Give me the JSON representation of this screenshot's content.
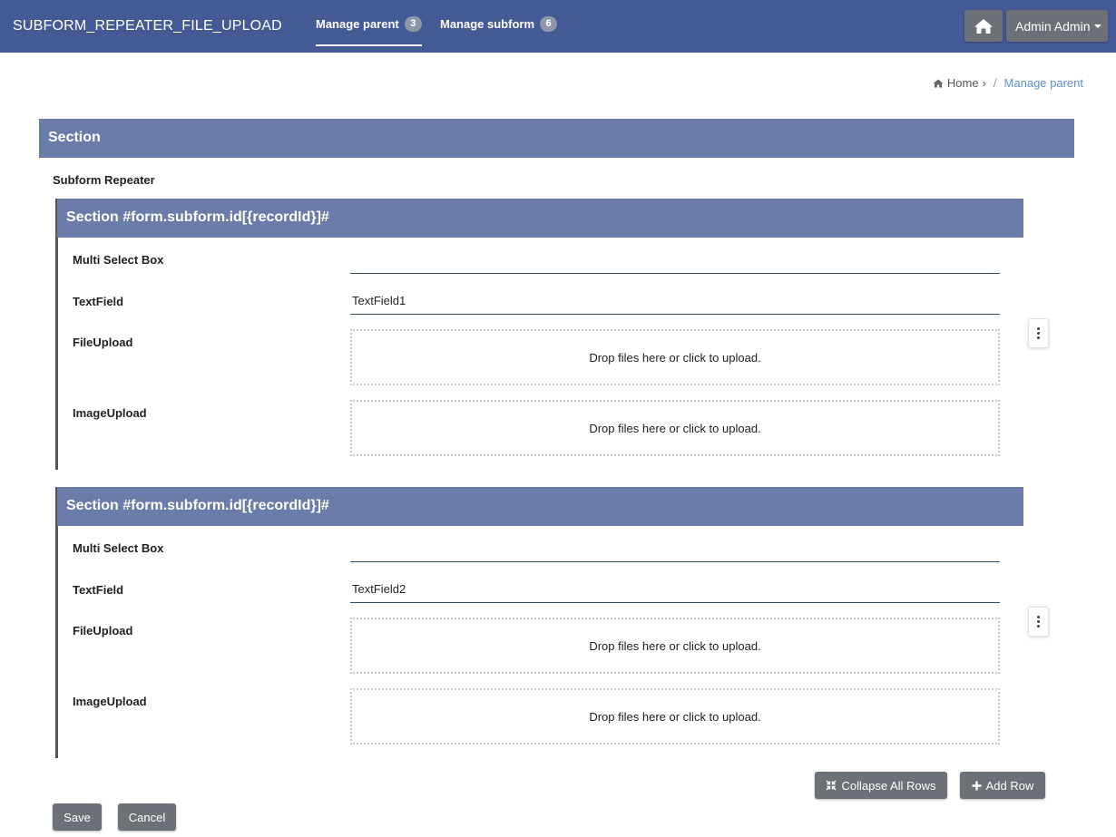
{
  "header": {
    "app_title": "SUBFORM_REPEATER_FILE_UPLOAD",
    "tabs": [
      {
        "label": "Manage parent",
        "badge": "3",
        "active": true
      },
      {
        "label": "Manage subform",
        "badge": "6",
        "active": false
      }
    ],
    "home_icon": "home-icon",
    "user_label": "Admin Admin"
  },
  "breadcrumb": {
    "home": "Home",
    "current": "Manage parent"
  },
  "section": {
    "title": "Section",
    "subform_label": "Subform Repeater"
  },
  "rows": [
    {
      "title": "Section #form.subform.id[{recordId}]#",
      "multi_select_label": "Multi Select Box",
      "multi_select_value": "",
      "textfield_label": "TextField",
      "textfield_value": "TextField1",
      "fileupload_label": "FileUpload",
      "fileupload_text": "Drop files here or click to upload.",
      "imageupload_label": "ImageUpload",
      "imageupload_text": "Drop files here or click to upload."
    },
    {
      "title": "Section #form.subform.id[{recordId}]#",
      "multi_select_label": "Multi Select Box",
      "multi_select_value": "",
      "textfield_label": "TextField",
      "textfield_value": "TextField2",
      "fileupload_label": "FileUpload",
      "fileupload_text": "Drop files here or click to upload.",
      "imageupload_label": "ImageUpload",
      "imageupload_text": "Drop files here or click to upload."
    }
  ],
  "actions": {
    "collapse_label": "Collapse All Rows",
    "add_row_label": "Add Row",
    "save_label": "Save",
    "cancel_label": "Cancel"
  },
  "colors": {
    "topbar": "#445a94",
    "section_header": "#6a7ca8",
    "button": "#6c7077",
    "link": "#5b8fd6"
  }
}
